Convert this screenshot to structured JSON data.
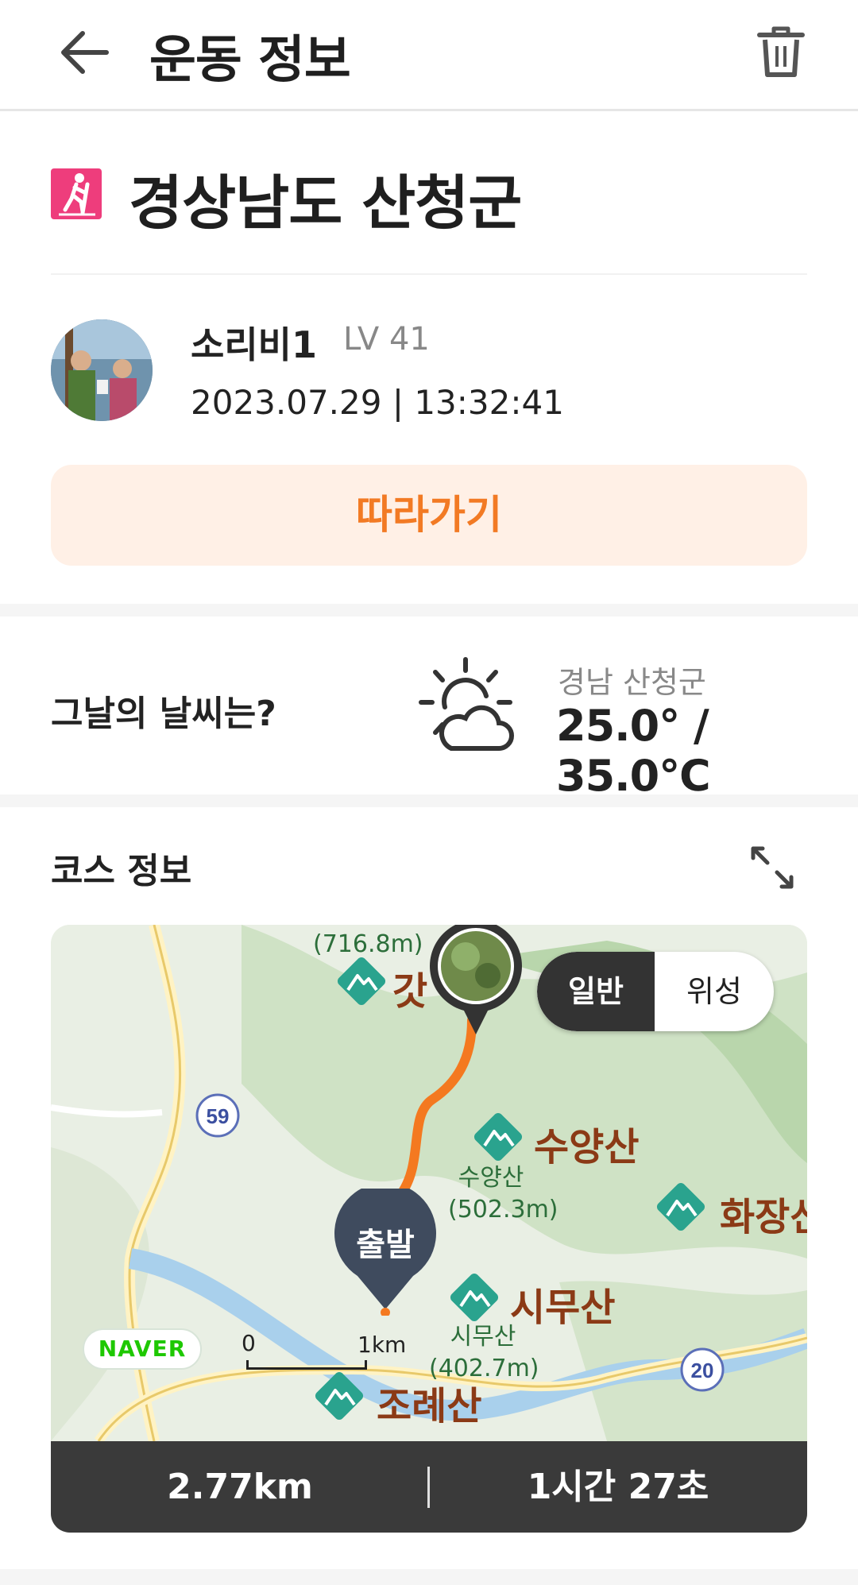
{
  "header": {
    "title": "운동 정보"
  },
  "activity": {
    "location_title": "경상남도 산청군"
  },
  "user": {
    "name": "소리비1",
    "level": "LV 41",
    "datetime": "2023.07.29 | 13:32:41"
  },
  "follow_button": {
    "label": "따라가기"
  },
  "weather": {
    "question": "그날의 날씨는?",
    "location": "경남 산청군",
    "temperature": "25.0° / 35.0℃"
  },
  "course": {
    "title": "코스 정보",
    "map": {
      "toggle_normal": "일반",
      "toggle_satellite": "위성",
      "start_label": "출발",
      "naver_label": "NAVER",
      "scale_zero": "0",
      "scale_km": "1km",
      "road_59": "59",
      "road_20": "20",
      "places": {
        "top_peak_partial": "갓",
        "top_peak_height": "(716.8m)",
        "suyangsan": "수양산",
        "suyangsan_sub": "수양산",
        "suyangsan_height": "(502.3m)",
        "hwajangsan": "화장산",
        "simusan": "시무산",
        "simusan_sub": "시무산",
        "simusan_height": "(402.7m)",
        "joryesan": "조례산"
      }
    },
    "stats": {
      "distance": "2.77km",
      "duration": "1시간 27초"
    }
  },
  "colors": {
    "accent": "#f27a24",
    "accent_bg": "#fff0e6",
    "route": "#f47920",
    "location_icon": "#ee3d7c"
  }
}
